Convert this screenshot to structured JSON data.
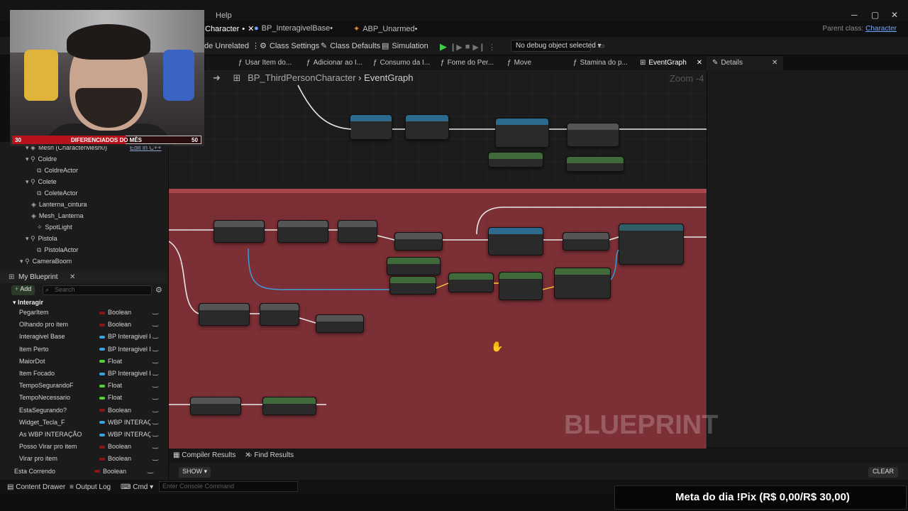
{
  "menu": {
    "help": "Help"
  },
  "window_controls": {
    "minimize": "─",
    "maximize": "▢",
    "close": "✕"
  },
  "tabs": [
    {
      "label": "Character",
      "active": true,
      "suffix": "•"
    },
    {
      "label": "BP_InteragivelBase•"
    },
    {
      "label": "ABP_Unarmed•"
    }
  ],
  "parent_class": {
    "label": "Parent class:",
    "value": "Character"
  },
  "toolbar": {
    "unrelated": "de Unrelated",
    "class_settings": "Class Settings",
    "class_defaults": "Class Defaults",
    "simulation": "Simulation",
    "debug_object": "No debug object selected"
  },
  "function_tabs": [
    "Usar Item do...",
    "Adicionar ao I...",
    "Consumo da I...",
    "Fome do Per...",
    "Move",
    "Stamina do p...",
    "EventGraph"
  ],
  "details": {
    "title": "Details"
  },
  "graph": {
    "breadcrumb_root": "BP_ThirdPersonCharacter",
    "breadcrumb_leaf": "EventGraph",
    "zoom": "Zoom -4",
    "watermark": "BLUEPRINT"
  },
  "components": [
    {
      "label": "Mesh (CharacterMesh0)",
      "edit": "Edit in C++"
    },
    {
      "label": "Coldre"
    },
    {
      "label": "ColdreActor"
    },
    {
      "label": "Colete"
    },
    {
      "label": "ColeteActor"
    },
    {
      "label": "Lanterna_cintura"
    },
    {
      "label": "Mesh_Lanterna"
    },
    {
      "label": "SpotLight"
    },
    {
      "label": "Pistola"
    },
    {
      "label": "PistolaActor"
    },
    {
      "label": "CameraBoom"
    }
  ],
  "my_blueprint": {
    "title": "My Blueprint",
    "add": "Add",
    "search_placeholder": "Search",
    "category": "Interagir",
    "variables": [
      {
        "name": "PegarItem",
        "type": "Boolean",
        "color": "#8a1515"
      },
      {
        "name": "Olhando pro item",
        "type": "Boolean",
        "color": "#8a1515"
      },
      {
        "name": "Interagivel Base",
        "type": "BP Interagivel E",
        "color": "#3aa0e0"
      },
      {
        "name": "Item Perto",
        "type": "BP Interagivel E",
        "color": "#3aa0e0"
      },
      {
        "name": "MaiorDot",
        "type": "Float",
        "color": "#55d13a"
      },
      {
        "name": "Item Focado",
        "type": "BP Interagivel E",
        "color": "#3aa0e0"
      },
      {
        "name": "TempoSegurandoF",
        "type": "Float",
        "color": "#55d13a"
      },
      {
        "name": "TempoNecessario",
        "type": "Float",
        "color": "#55d13a"
      },
      {
        "name": "EstaSegurando?",
        "type": "Boolean",
        "color": "#8a1515"
      },
      {
        "name": "Widget_Tecla_F",
        "type": "WBP INTERAÇÃ",
        "color": "#3aa0e0"
      },
      {
        "name": "As WBP INTERAÇÃO",
        "type": "WBP INTERAÇÃ",
        "color": "#3aa0e0"
      },
      {
        "name": "Posso Virar pro item",
        "type": "Boolean",
        "color": "#8a1515"
      },
      {
        "name": "Virar pro item",
        "type": "Boolean",
        "color": "#8a1515"
      },
      {
        "name": "Esta Correndo",
        "type": "Boolean",
        "color": "#8a1515"
      }
    ]
  },
  "bottom": {
    "compiler_results": "Compiler Results",
    "find_results": "Find Results",
    "show": "SHOW",
    "clear": "CLEAR"
  },
  "status": {
    "content_drawer": "Content Drawer",
    "output_log": "Output Log",
    "cmd": "Cmd",
    "console_placeholder": "Enter Console Command"
  },
  "stream": {
    "goal_left": "30",
    "goal_title": "DIFERENCIADOS DO MÊS",
    "goal_right": "50",
    "goal_progress": 0.6,
    "meta": "Meta do dia !Pix (R$ 0,00/R$ 30,00)"
  }
}
